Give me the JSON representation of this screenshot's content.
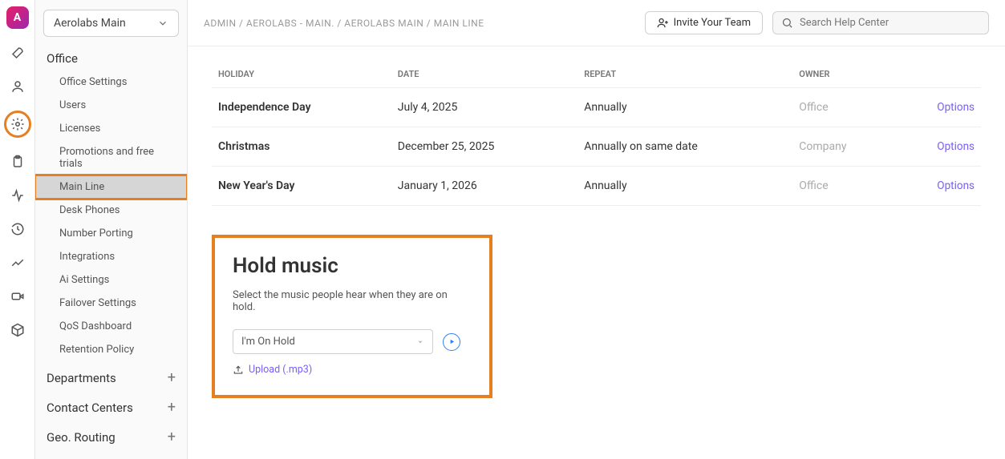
{
  "selector_label": "Aerolabs Main",
  "breadcrumb": "ADMIN / AEROLABS - MAIN. / AEROLABS MAIN / MAIN LINE",
  "invite_label": "Invite Your Team",
  "search_placeholder": "Search Help Center",
  "sidebar": {
    "office_label": "Office",
    "items": [
      "Office Settings",
      "Users",
      "Licenses",
      "Promotions and free trials",
      "Main Line",
      "Desk Phones",
      "Number Porting",
      "Integrations",
      "Ai Settings",
      "Failover Settings",
      "QoS Dashboard",
      "Retention Policy"
    ],
    "departments_label": "Departments",
    "contactcenters_label": "Contact Centers",
    "georouting_label": "Geo. Routing"
  },
  "table": {
    "headers": {
      "holiday": "HOLIDAY",
      "date": "DATE",
      "repeat": "REPEAT",
      "owner": "OWNER"
    },
    "rows": [
      {
        "holiday": "Independence Day",
        "date": "July 4, 2025",
        "repeat": "Annually",
        "owner": "Office",
        "opt": "Options"
      },
      {
        "holiday": "Christmas",
        "date": "December 25, 2025",
        "repeat": "Annually on same date",
        "owner": "Company",
        "opt": "Options"
      },
      {
        "holiday": "New Year's Day",
        "date": "January 1, 2026",
        "repeat": "Annually",
        "owner": "Office",
        "opt": "Options"
      }
    ]
  },
  "hold": {
    "title": "Hold music",
    "desc": "Select the music people hear when they are on hold.",
    "selected": "I'm On Hold",
    "upload": "Upload (.mp3)"
  }
}
